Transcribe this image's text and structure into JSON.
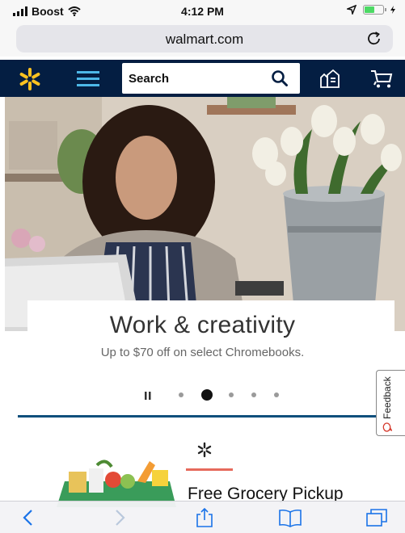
{
  "status_bar": {
    "carrier": "Boost",
    "time": "4:12 PM"
  },
  "browser": {
    "url": "walmart.com"
  },
  "header": {
    "search_label": "Search",
    "colors": {
      "header_bg": "#041e42",
      "spark": "#ffc220",
      "accent": "#4db8e8"
    }
  },
  "hero": {
    "title": "Work & creativity",
    "subtitle": "Up to $70 off on select Chromebooks.",
    "carousel": {
      "slide_count": 5,
      "active_index": 1
    }
  },
  "feedback": {
    "label": "Feedback"
  },
  "grocery": {
    "title": "Free Grocery Pickup"
  },
  "icons": {
    "reload": "reload-icon",
    "spark": "spark-logo-icon",
    "menu": "hamburger-menu-icon",
    "search": "search-icon",
    "reorder": "reorder-icon",
    "cart": "cart-icon",
    "pause": "pause-icon",
    "back": "back-arrow-icon",
    "forward": "forward-arrow-icon",
    "share": "share-icon",
    "bookmarks": "bookmarks-icon",
    "tabs": "tabs-icon"
  }
}
